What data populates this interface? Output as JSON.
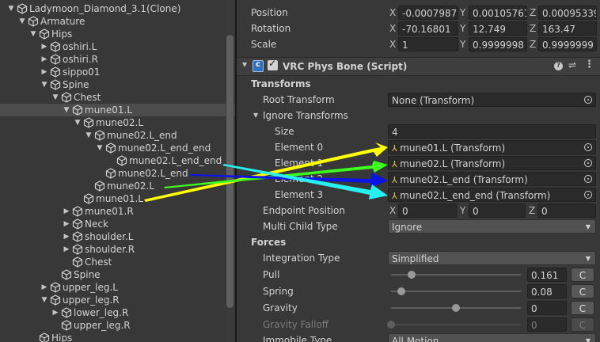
{
  "hierarchy": {
    "rows": [
      {
        "label": "Ladymoon_Diamond_3.1(Clone)",
        "fold": "open"
      },
      {
        "label": "Armature",
        "fold": "open"
      },
      {
        "label": "Hips",
        "fold": "open"
      },
      {
        "label": "oshiri.L",
        "fold": "closed"
      },
      {
        "label": "oshiri.R",
        "fold": "closed"
      },
      {
        "label": "sippo01",
        "fold": "closed"
      },
      {
        "label": "Spine",
        "fold": "open"
      },
      {
        "label": "Chest",
        "fold": "open"
      },
      {
        "label": "mune01.L",
        "fold": "open",
        "selected": true
      },
      {
        "label": "mune02.L",
        "fold": "open"
      },
      {
        "label": "mune02.L_end",
        "fold": "open"
      },
      {
        "label": "mune02.L_end_end",
        "fold": "open"
      },
      {
        "label": "mune02.L_end_end",
        "fold": "none"
      },
      {
        "label": "mune02.L_end",
        "fold": "none"
      },
      {
        "label": "mune02.L",
        "fold": "none"
      },
      {
        "label": "mune01.L",
        "fold": "none"
      },
      {
        "label": "mune01.R",
        "fold": "closed"
      },
      {
        "label": "Neck",
        "fold": "closed"
      },
      {
        "label": "shoulder.L",
        "fold": "closed"
      },
      {
        "label": "shoulder.R",
        "fold": "closed"
      },
      {
        "label": "Chest",
        "fold": "none"
      },
      {
        "label": "Spine",
        "fold": "none"
      },
      {
        "label": "upper_leg.L",
        "fold": "closed"
      },
      {
        "label": "upper_leg.R",
        "fold": "open"
      },
      {
        "label": "lower_leg.R",
        "fold": "closed"
      },
      {
        "label": "upper_leg.R",
        "fold": "none"
      },
      {
        "label": "Hips",
        "fold": "none"
      }
    ]
  },
  "transform": {
    "position": {
      "label": "Position",
      "x": "-0.0007987",
      "y": "0.00105761",
      "z": "0.00095339"
    },
    "rotation": {
      "label": "Rotation",
      "x": "-70.16801",
      "y": "12.749",
      "z": "163.47"
    },
    "scale": {
      "label": "Scale",
      "x": "1",
      "y": "0.9999998",
      "z": "0.9999999"
    },
    "axis_x": "X",
    "axis_y": "Y",
    "axis_z": "Z"
  },
  "component": {
    "title": "VRC Phys Bone (Script)",
    "enabled": true
  },
  "transforms_section": {
    "header": "Transforms",
    "root_transform_label": "Root Transform",
    "root_transform_value": "None (Transform)",
    "ignore_transforms_label": "Ignore Transforms",
    "size_label": "Size",
    "size_value": "4",
    "elements": [
      {
        "label": "Element 0",
        "value": "mune01.L (Transform)"
      },
      {
        "label": "Element 1",
        "value": "mune02.L (Transform)"
      },
      {
        "label": "Element 2",
        "value": "mune02.L_end (Transform)"
      },
      {
        "label": "Element 3",
        "value": "mune02.L_end_end (Transform)"
      }
    ],
    "endpoint_label": "Endpoint Position",
    "endpoint": {
      "x": "0",
      "y": "0",
      "z": "0"
    },
    "multi_child_label": "Multi Child Type",
    "multi_child_value": "Ignore"
  },
  "forces_section": {
    "header": "Forces",
    "integration_label": "Integration Type",
    "integration_value": "Simplified",
    "pull": {
      "label": "Pull",
      "value": "0.161",
      "fraction": 0.161
    },
    "spring": {
      "label": "Spring",
      "value": "0.08",
      "fraction": 0.08
    },
    "gravity": {
      "label": "Gravity",
      "value": "0",
      "fraction": 0.5
    },
    "gravity_falloff": {
      "label": "Gravity Falloff",
      "value": "0",
      "fraction": 0.0
    },
    "curve_button": "C",
    "immobile_label": "Immobile Type",
    "immobile_value": "All Motion"
  },
  "colors": {
    "arrow_yellow": "#ffff00",
    "arrow_green": "#3cff1e",
    "arrow_blue": "#0a14e6",
    "arrow_cyan": "#28f0f0"
  }
}
